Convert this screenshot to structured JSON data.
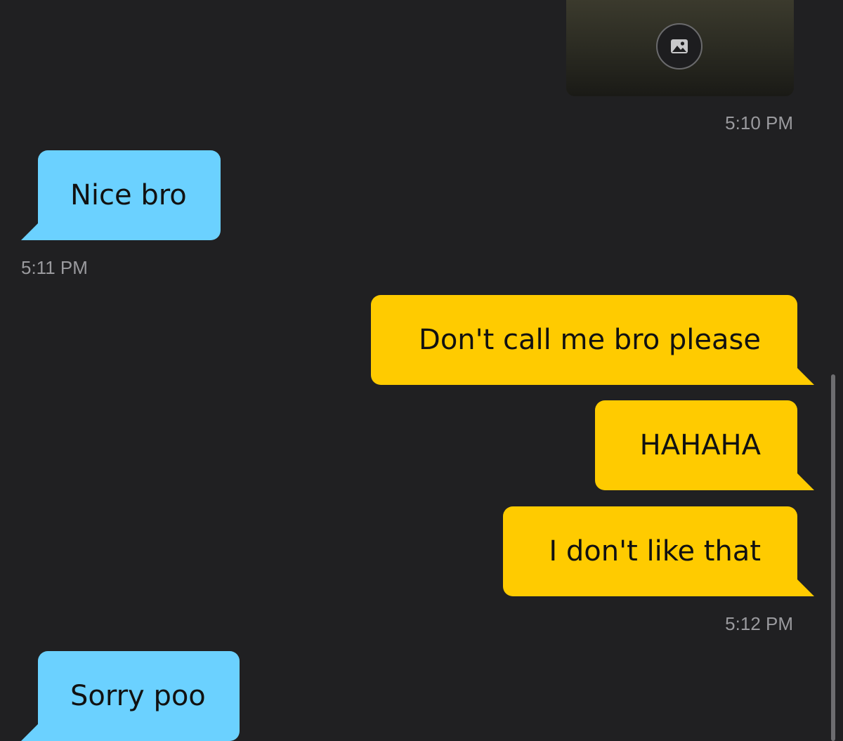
{
  "chat": {
    "image_message": {
      "icon": "image-icon",
      "timestamp": "5:10 PM"
    },
    "messages": [
      {
        "direction": "incoming",
        "text": "Nice bro",
        "timestamp": "5:11 PM"
      },
      {
        "direction": "outgoing",
        "text": "Don't call me bro please"
      },
      {
        "direction": "outgoing",
        "text": "HAHAHA"
      },
      {
        "direction": "outgoing",
        "text": "I don't like that",
        "timestamp": "5:12 PM"
      },
      {
        "direction": "incoming",
        "text": "Sorry poo"
      }
    ]
  },
  "colors": {
    "background": "#202022",
    "incoming_bubble": "#6bd1ff",
    "outgoing_bubble": "#ffcb00",
    "timestamp_text": "#9a9a9e"
  }
}
